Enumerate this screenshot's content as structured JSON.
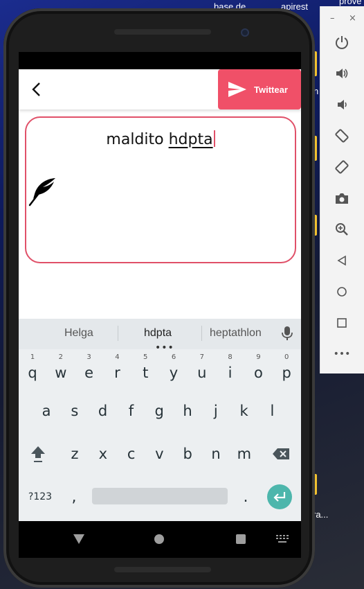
{
  "desktop": {
    "labels": [
      "base de",
      "apirest",
      "prove",
      "n",
      "ra..."
    ]
  },
  "app": {
    "tweet_button_label": "Twittear",
    "compose": {
      "text_plain": "maldito ",
      "text_underlined": "hdpta"
    }
  },
  "keyboard": {
    "suggestions": [
      "Helga",
      "hdpta",
      "heptathlon"
    ],
    "suggestion_dots": "•••",
    "row1": [
      {
        "num": "1",
        "letter": "q"
      },
      {
        "num": "2",
        "letter": "w"
      },
      {
        "num": "3",
        "letter": "e"
      },
      {
        "num": "4",
        "letter": "r"
      },
      {
        "num": "5",
        "letter": "t"
      },
      {
        "num": "6",
        "letter": "y"
      },
      {
        "num": "7",
        "letter": "u"
      },
      {
        "num": "8",
        "letter": "i"
      },
      {
        "num": "9",
        "letter": "o"
      },
      {
        "num": "0",
        "letter": "p"
      }
    ],
    "row2": [
      "a",
      "s",
      "d",
      "f",
      "g",
      "h",
      "j",
      "k",
      "l"
    ],
    "row3": [
      "z",
      "x",
      "c",
      "v",
      "b",
      "n",
      "m"
    ],
    "symbols_label": "?123",
    "comma": ",",
    "period": "."
  },
  "emulator_toolbar": {
    "minimize": "–",
    "close": "×",
    "more": "•••",
    "buttons": [
      "power-icon",
      "volume-up-icon",
      "volume-down-icon",
      "rotate-left-icon",
      "rotate-right-icon",
      "camera-icon",
      "zoom-icon",
      "back-icon",
      "home-icon",
      "overview-icon"
    ]
  },
  "colors": {
    "accent": "#f05068",
    "border": "#e05068",
    "enter_key": "#4db6ac"
  }
}
